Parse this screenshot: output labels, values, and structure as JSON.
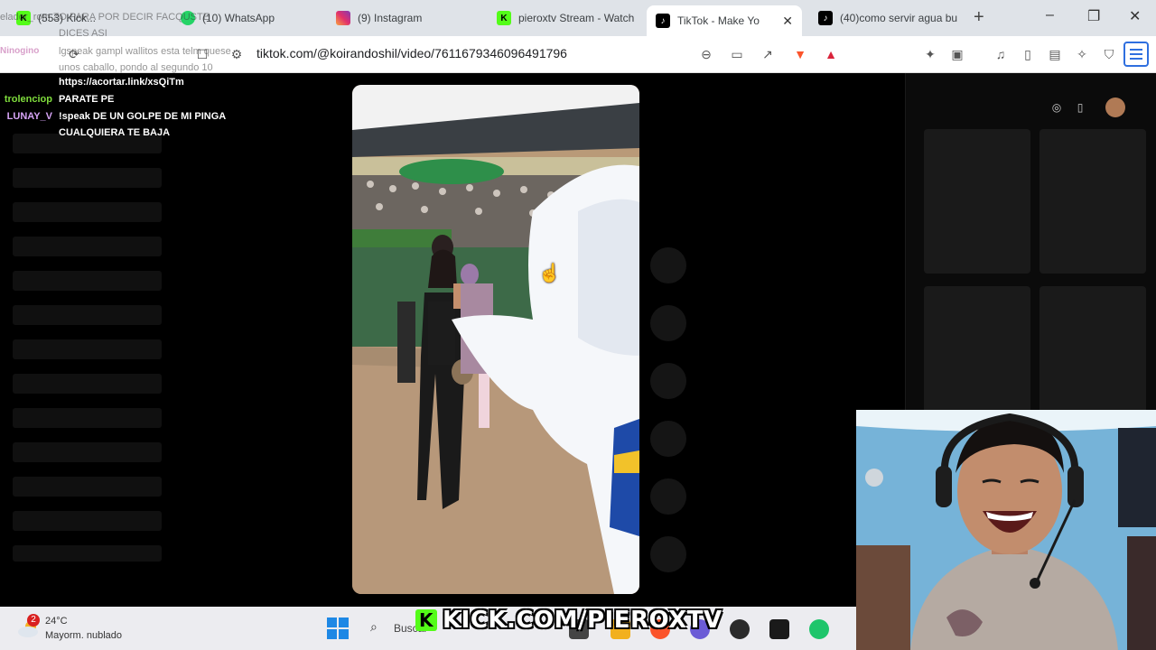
{
  "tabs": [
    {
      "label": "(553) Kick...",
      "favicon": "kick-icon",
      "color": "#53fc18"
    },
    {
      "label": "(10) WhatsApp",
      "favicon": "whatsapp-icon",
      "color": "#25d366"
    },
    {
      "label": "(9) Instagram",
      "favicon": "instagram-icon",
      "color": "#e1306c"
    },
    {
      "label": "pieroxtv Stream - Watch",
      "favicon": "kick-icon",
      "color": "#53fc18"
    },
    {
      "label": "TikTok - Make Yo",
      "favicon": "tiktok-icon",
      "color": "#000000"
    },
    {
      "label": "(40)como servir agua bu",
      "favicon": "tiktok-icon",
      "color": "#000000"
    }
  ],
  "active_tab_close": "✕",
  "new_tab": "+",
  "window_controls": {
    "minimize": "–",
    "maximize": "❐",
    "close": "✕"
  },
  "address_bar": {
    "url": "tiktok.com/@koirandoshil/video/7611679346096491796"
  },
  "chat": {
    "faded_lines": [
      "elador_rom  ZO PARA POR DECIR FACQUSTE",
      "DICES ASI",
      "lgspeak gampl wallitos esta telm quese",
      "unos caballo, pondo al segundo 10"
    ],
    "faded_user": "Ninogino",
    "link": "https://acortar.link/xsQiTm",
    "messages": [
      {
        "user": "trolenciop",
        "text": "PARATE PE",
        "color": "#7fdc3c"
      },
      {
        "user": "LUNAY_V",
        "text": "!speak DE UN GOLPE DE MI PINGA",
        "color": "#d6a3f5"
      },
      {
        "user": "",
        "text": "CUALQUIERA TE BAJA",
        "color": "#ffffff"
      }
    ]
  },
  "taskbar": {
    "weather_badge": "2",
    "temperature": "24°C",
    "weather_desc": "Mayorm. nublado",
    "search_placeholder": "Buscar"
  },
  "overlay": {
    "kick_url": "KICK.COM/PIEROXTV",
    "kick_logo": "K"
  },
  "colors": {
    "kick_green": "#53fc18",
    "accent_blue": "#2f6fdf"
  }
}
